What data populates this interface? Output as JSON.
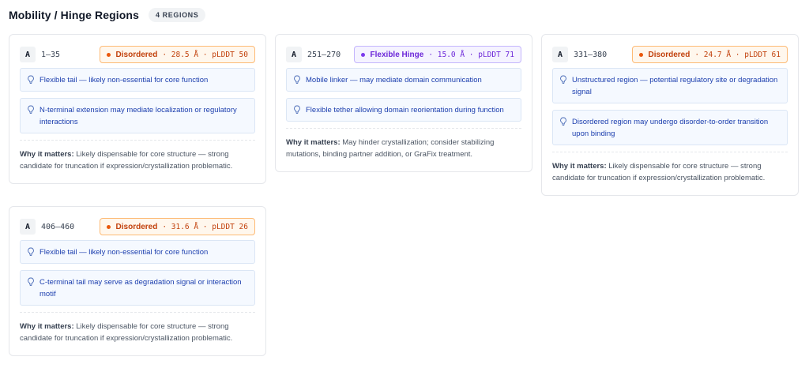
{
  "header": {
    "title": "Mobility / Hinge Regions",
    "count": "4 REGIONS"
  },
  "colors": {
    "disordered_accent": "#c2410c",
    "hinge_accent": "#6d28d9",
    "note_text": "#1e40af"
  },
  "cards": [
    {
      "chain": "A",
      "range": "1–35",
      "status": "Disordered",
      "metrics": "· 28.5 Å · pLDDT 50",
      "notes": [
        "Flexible tail — likely non-essential for core function",
        "N-terminal extension may mediate localization or regulatory interactions"
      ],
      "why_label": "Why it matters:",
      "why_text": "Likely dispensable for core structure — strong candidate for truncation if expression/crystallization problematic."
    },
    {
      "chain": "A",
      "range": "251–270",
      "status": "Flexible Hinge",
      "metrics": "· 15.0 Å · pLDDT 71",
      "notes": [
        "Mobile linker — may mediate domain communication",
        "Flexible tether allowing domain reorientation during function"
      ],
      "why_label": "Why it matters:",
      "why_text": "May hinder crystallization; consider stabilizing mutations, binding partner addition, or GraFix treatment."
    },
    {
      "chain": "A",
      "range": "331–380",
      "status": "Disordered",
      "metrics": "· 24.7 Å · pLDDT 61",
      "notes": [
        "Unstructured region — potential regulatory site or degradation signal",
        "Disordered region may undergo disorder-to-order transition upon binding"
      ],
      "why_label": "Why it matters:",
      "why_text": "Likely dispensable for core structure — strong candidate for truncation if expression/crystallization problematic."
    },
    {
      "chain": "A",
      "range": "406–460",
      "status": "Disordered",
      "metrics": "· 31.6 Å · pLDDT 26",
      "notes": [
        "Flexible tail — likely non-essential for core function",
        "C-terminal tail may serve as degradation signal or interaction motif"
      ],
      "why_label": "Why it matters:",
      "why_text": "Likely dispensable for core structure — strong candidate for truncation if expression/crystallization problematic."
    }
  ]
}
